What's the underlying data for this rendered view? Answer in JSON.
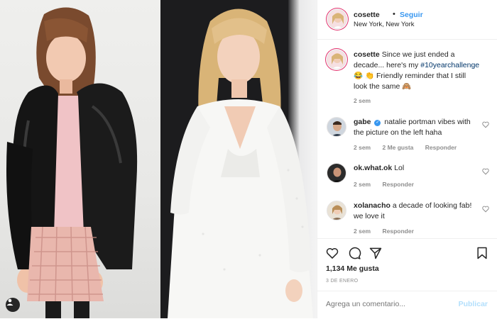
{
  "post": {
    "username": "cosette",
    "follow_label": "Seguir",
    "dot": "•",
    "location": "New York, New York"
  },
  "caption": {
    "username": "cosette",
    "text_before": "Since we just ended a decade... here's my",
    "hashtag": "#10yearchallenge",
    "text_after": "Friendly reminder that I still look the same",
    "emoji_1": "😂",
    "emoji_2": "👏",
    "emoji_3": "🙈",
    "time": "2 sem"
  },
  "comments": [
    {
      "username": "gabe",
      "verified": true,
      "verified_icon": "verified-badge-icon",
      "text": "natalie portman vibes with the picture on the left haha",
      "time": "2 sem",
      "likes": "2 Me gusta",
      "reply": "Responder"
    },
    {
      "username": "ok.what.ok",
      "text": "Lol",
      "time": "2 sem",
      "reply": "Responder"
    },
    {
      "username": "xolanacho",
      "text": "a decade of looking fab! we love it",
      "time": "2 sem",
      "reply": "Responder"
    }
  ],
  "actions": {
    "likes": "1,134 Me gusta",
    "date": "3 DE ENERO",
    "icons": [
      "heart-icon",
      "comment-icon",
      "share-icon",
      "bookmark-icon"
    ]
  },
  "comment_box": {
    "placeholder": "Agrega un comentario...",
    "publish": "Publicar"
  },
  "colors": {
    "link_blue": "#3897f0",
    "publish_disabled": "#b2dffc",
    "muted": "#8e8e8e",
    "text": "#262626"
  }
}
